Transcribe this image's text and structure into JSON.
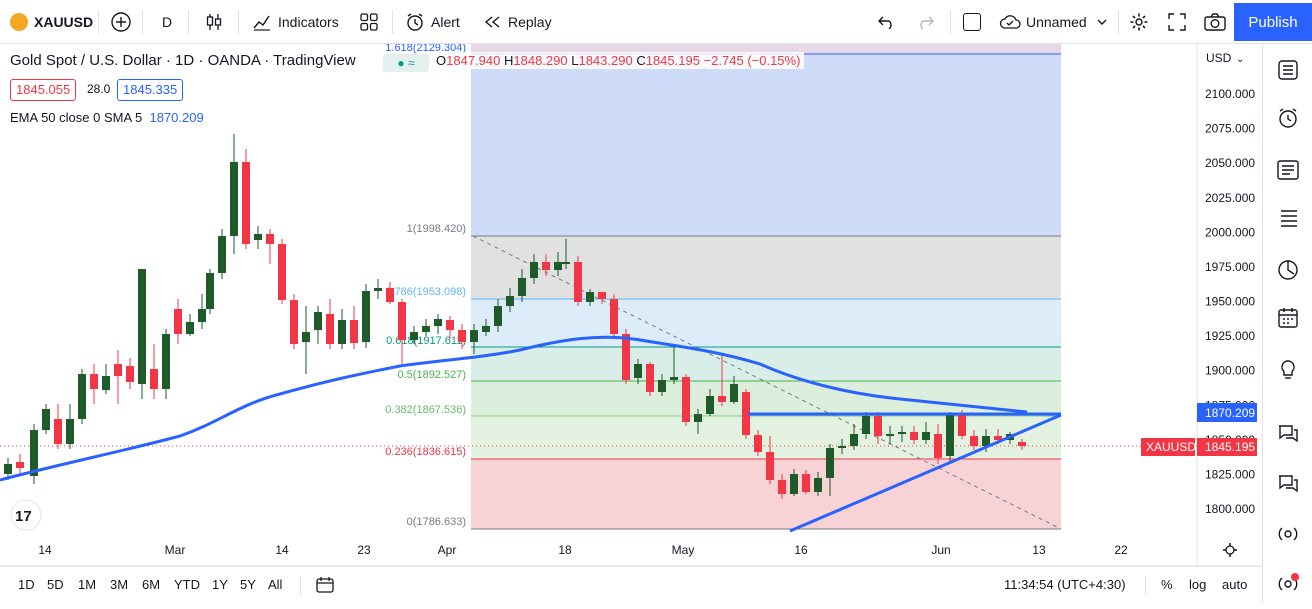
{
  "toolbar": {
    "symbol": "XAUUSD",
    "interval": "D",
    "indicators_label": "Indicators",
    "alert_label": "Alert",
    "replay_label": "Replay",
    "layout_name": "Unnamed",
    "publish_label": "Publish"
  },
  "legend": {
    "title": "Gold Spot / U.S. Dollar · 1D · OANDA · TradingView",
    "open_label": "O",
    "open": "1847.940",
    "high_label": "H",
    "high": "1848.290",
    "low_label": "L",
    "low": "1843.290",
    "close_label": "C",
    "close": "1845.195",
    "change": "−2.745 (−0.15%)",
    "bid": "1845.055",
    "spread": "28.0",
    "ask": "1845.335",
    "ema_label": "EMA 50 close 0 SMA 5",
    "ema_value": "1870.209"
  },
  "axis": {
    "currency": "USD",
    "price_ticks": [
      "2100.000",
      "2075.000",
      "2050.000",
      "2025.000",
      "2000.000",
      "1975.000",
      "1950.000",
      "1925.000",
      "1900.000",
      "1875.000",
      "1850.000",
      "1825.000",
      "1800.000"
    ],
    "date_ticks": [
      "14",
      "Mar",
      "14",
      "23",
      "Apr",
      "18",
      "May",
      "16",
      "Jun",
      "13",
      "22"
    ],
    "ema_tag": "1870.209",
    "symbol_tag": "XAUUSD",
    "price_tag": "1845.195"
  },
  "fib_levels": [
    {
      "label": "1.618(2129.304)"
    },
    {
      "label": "1(1998.420)"
    },
    {
      "label": "0.786(1953.098)"
    },
    {
      "label": "0.618(1917.611)"
    },
    {
      "label": "0.5(1892.527)"
    },
    {
      "label": "0.382(1867.536)"
    },
    {
      "label": "0.236(1836.615)"
    },
    {
      "label": "0(1786.633)"
    }
  ],
  "bottom": {
    "ranges": [
      "1D",
      "5D",
      "1M",
      "3M",
      "6M",
      "YTD",
      "1Y",
      "5Y",
      "All"
    ],
    "time": "11:34:54 (UTC+4:30)",
    "pct": "%",
    "log": "log",
    "auto": "auto"
  },
  "colors": {
    "up": "#089981",
    "down": "#f23645",
    "ema": "#2962ff",
    "accent": "#2962ff"
  }
}
